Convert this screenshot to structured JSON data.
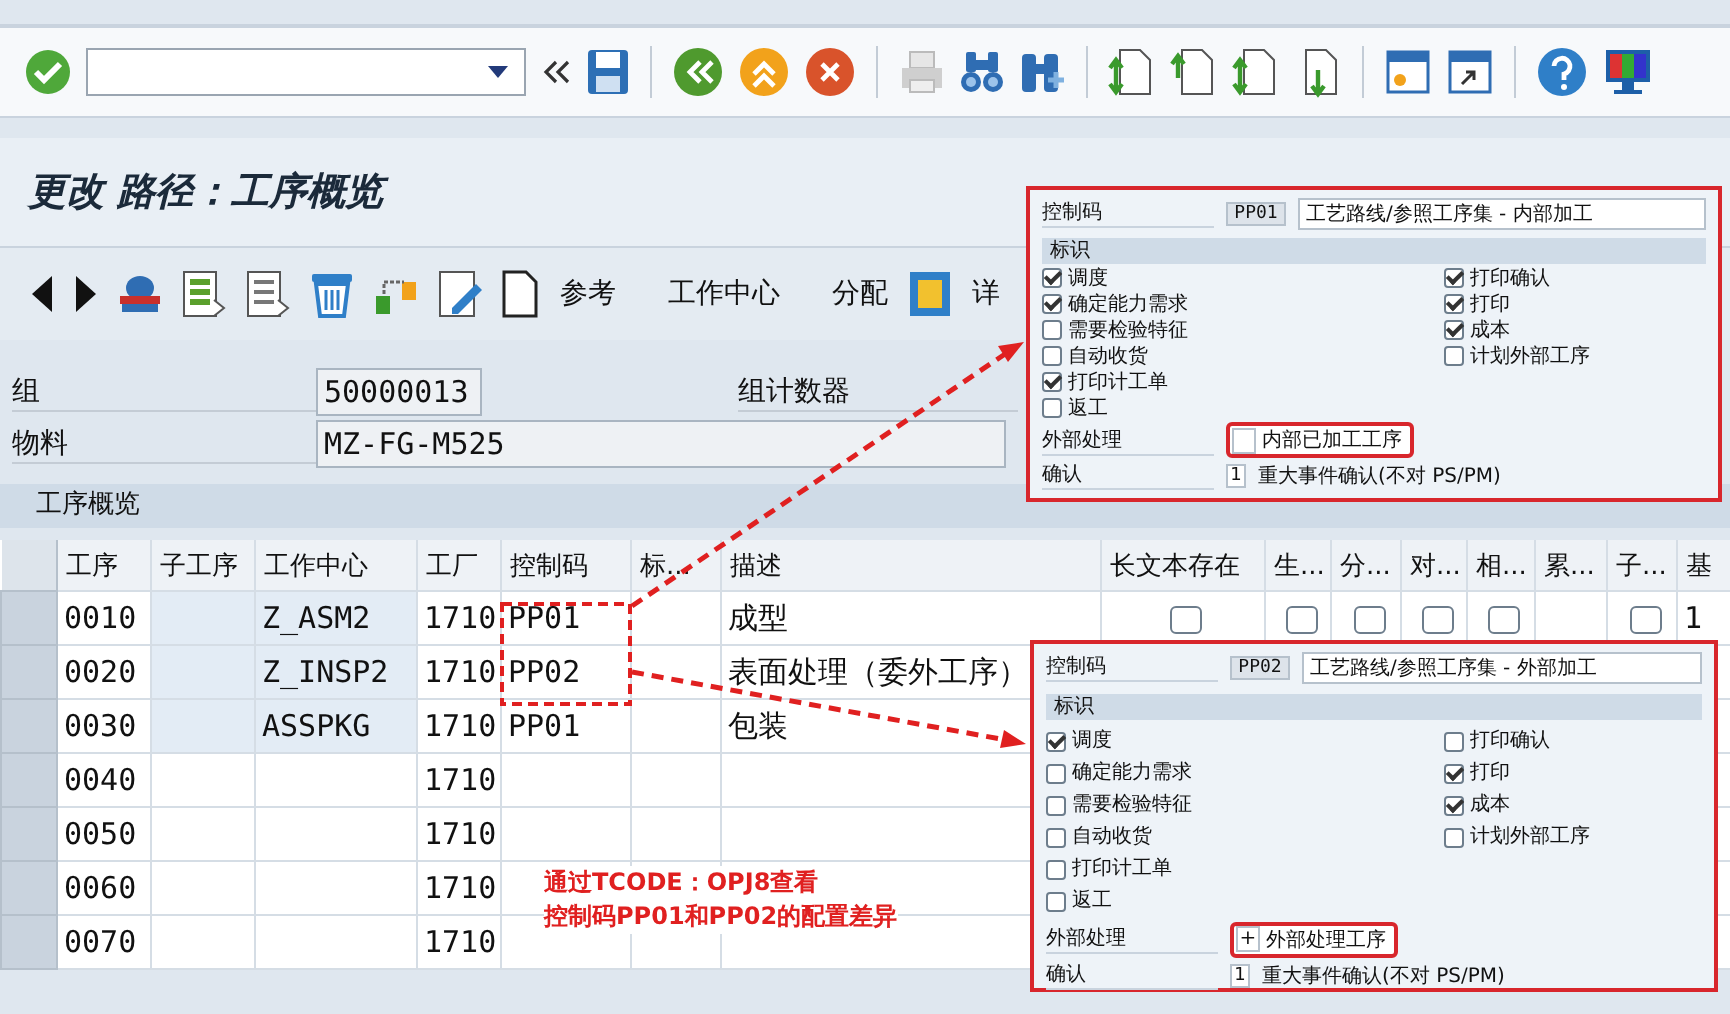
{
  "title": "更改 路径：工序概览",
  "app_toolbar": {
    "reference": "参考",
    "buttons": [
      "工作中心",
      "分配"
    ],
    "detail": "详"
  },
  "header_fields": [
    {
      "label": "组",
      "value": "50000013",
      "label2": "组计数器"
    },
    {
      "label": "物料",
      "value": "MZ-FG-M525"
    }
  ],
  "table": {
    "title": "工序概览",
    "columns": [
      {
        "label": "工序",
        "kind": "text"
      },
      {
        "label": "子工序",
        "kind": "input"
      },
      {
        "label": "工作中心",
        "kind": "input"
      },
      {
        "label": "工厂",
        "kind": "text"
      },
      {
        "label": "控制码",
        "kind": "text"
      },
      {
        "label": "标...",
        "kind": "text"
      },
      {
        "label": "描述",
        "kind": "text"
      },
      {
        "label": "长文本存在",
        "kind": "check"
      },
      {
        "label": "生...",
        "kind": "check"
      },
      {
        "label": "分...",
        "kind": "check"
      },
      {
        "label": "对...",
        "kind": "check"
      },
      {
        "label": "相...",
        "kind": "check"
      },
      {
        "label": "累...",
        "kind": "text"
      },
      {
        "label": "子...",
        "kind": "check"
      },
      {
        "label": "基",
        "kind": "text"
      }
    ],
    "rows": [
      {
        "cells": [
          "0010",
          null,
          "Z_ASM2",
          "1710",
          "PP01",
          null,
          "成型",
          {
            "checked": false
          },
          {
            "checked": false
          },
          {
            "checked": false
          },
          {
            "checked": false
          },
          {
            "checked": false
          },
          null,
          {
            "checked": false
          },
          "1"
        ]
      },
      {
        "cells": [
          "0020",
          null,
          "Z_INSP2",
          "1710",
          "PP02",
          null,
          "表面处理（委外工序）"
        ]
      },
      {
        "cells": [
          "0030",
          null,
          "ASSPKG",
          "1710",
          "PP01",
          null,
          "包装"
        ]
      },
      {
        "cells": [
          "0040",
          null,
          null,
          "1710"
        ]
      },
      {
        "cells": [
          "0050",
          null,
          null,
          "1710"
        ]
      },
      {
        "cells": [
          "0060",
          null,
          null,
          "1710"
        ]
      },
      {
        "cells": [
          "0070",
          null,
          null,
          "1710"
        ]
      }
    ]
  },
  "insets": [
    {
      "code_label": "控制码",
      "code": "PP01",
      "description": "工艺路线/参照工序集 - 内部加工",
      "section": "标识",
      "checks_left": [
        {
          "label": "调度",
          "checked": true
        },
        {
          "label": "确定能力需求",
          "checked": true
        },
        {
          "label": "需要检验特征",
          "checked": false
        },
        {
          "label": "自动收货",
          "checked": false
        },
        {
          "label": "打印计工单",
          "checked": true
        },
        {
          "label": "返工",
          "checked": false
        }
      ],
      "checks_right": [
        {
          "label": "打印确认",
          "checked": true
        },
        {
          "label": "打印",
          "checked": true
        },
        {
          "label": "成本",
          "checked": true
        },
        {
          "label": "计划外部工序",
          "checked": false
        }
      ],
      "external_label": "外部处理",
      "external_text": "内部已加工工序",
      "confirm_label": "确认",
      "confirm_code": "1",
      "confirm_text": "重大事件确认(不对 PS/PM)"
    },
    {
      "code_label": "控制码",
      "code": "PP02",
      "description": "工艺路线/参照工序集 - 外部加工",
      "section": "标识",
      "checks_left": [
        {
          "label": "调度",
          "checked": true
        },
        {
          "label": "确定能力需求",
          "checked": false
        },
        {
          "label": "需要检验特征",
          "checked": false
        },
        {
          "label": "自动收货",
          "checked": false
        },
        {
          "label": "打印计工单",
          "checked": false
        },
        {
          "label": "返工",
          "checked": false
        }
      ],
      "checks_right": [
        {
          "label": "打印确认",
          "checked": false
        },
        {
          "label": "打印",
          "checked": true
        },
        {
          "label": "成本",
          "checked": true
        },
        {
          "label": "计划外部工序",
          "checked": false
        }
      ],
      "external_label": "外部处理",
      "external_code": "+",
      "external_text": "外部处理工序",
      "confirm_label": "确认",
      "confirm_code": "1",
      "confirm_text": "重大事件确认(不对 PS/PM)"
    }
  ],
  "annotation": [
    "通过TCODE：OPJ8查看",
    "控制码PP01和PP02的配置差异"
  ]
}
